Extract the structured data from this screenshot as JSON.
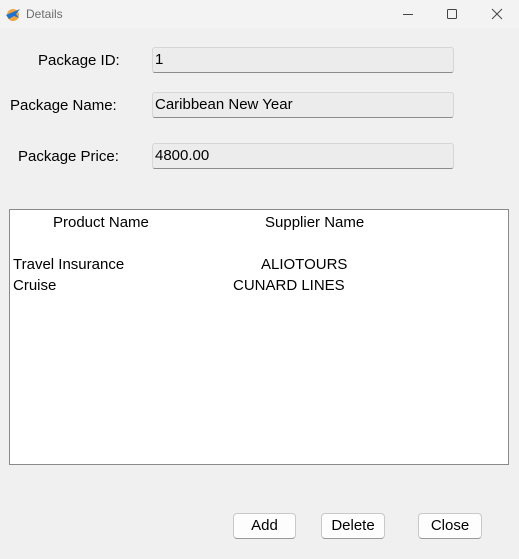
{
  "window": {
    "title": "Details",
    "accent_color": "#1e73d2",
    "icons": {
      "app": "plane-logo-icon",
      "minimize": "minimize-icon",
      "maximize": "maximize-icon",
      "close": "close-icon"
    }
  },
  "form": {
    "package_id_label": "Package ID:",
    "package_id_value": "1",
    "package_name_label": "Package Name:",
    "package_name_value": "Caribbean New Year",
    "package_price_label": "Package Price:",
    "package_price_value": "4800.00"
  },
  "products": {
    "columns": [
      "Product Name",
      "Supplier Name"
    ],
    "rows": [
      {
        "product": "Travel Insurance",
        "supplier": "ALIOTOURS"
      },
      {
        "product": "Cruise",
        "supplier": "CUNARD LINES"
      }
    ]
  },
  "buttons": {
    "add": "Add",
    "delete": "Delete",
    "close": "Close"
  }
}
